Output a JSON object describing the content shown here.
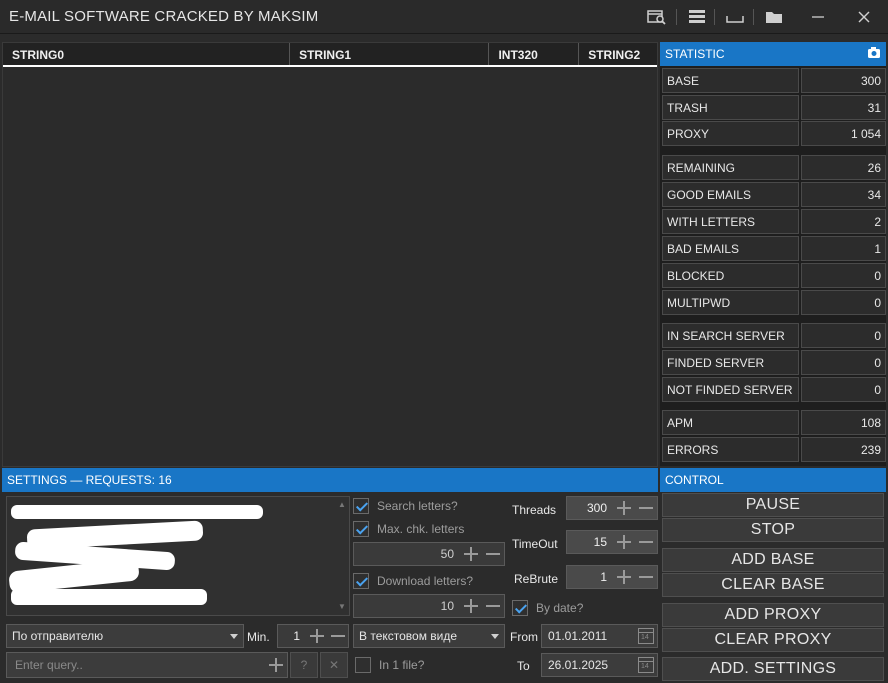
{
  "window": {
    "title": "E-MAIL SOFTWARE CRACKED BY MAKSIM"
  },
  "table": {
    "columns": [
      "STRING0",
      "STRING1",
      "INT320",
      "STRING2"
    ]
  },
  "statistic": {
    "header": "STATISTIC",
    "rows": [
      {
        "label": "BASE",
        "value": "300"
      },
      {
        "label": "TRASH",
        "value": "31"
      },
      {
        "label": "PROXY",
        "value": "1 054"
      },
      {
        "label": "REMAINING",
        "value": "26"
      },
      {
        "label": "GOOD EMAILS",
        "value": "34"
      },
      {
        "label": "WITH LETTERS",
        "value": "2"
      },
      {
        "label": "BAD EMAILS",
        "value": "1"
      },
      {
        "label": "BLOCKED",
        "value": "0"
      },
      {
        "label": "MULTIPWD",
        "value": "0"
      },
      {
        "label": "IN SEARCH SERVER",
        "value": "0"
      },
      {
        "label": "FINDED SERVER",
        "value": "0"
      },
      {
        "label": "NOT FINDED SERVER",
        "value": "0"
      },
      {
        "label": "APM",
        "value": "108"
      },
      {
        "label": "ERRORS",
        "value": "239"
      }
    ]
  },
  "settings": {
    "header": "SETTINGS — REQUESTS: 16",
    "search_letters": "Search letters?",
    "max_chk_letters": "Max. chk. letters",
    "max_chk_value": "50",
    "download_letters": "Download letters?",
    "download_value": "10",
    "threads_label": "Threads",
    "threads_value": "300",
    "timeout_label": "TimeOut",
    "timeout_value": "15",
    "rebrute_label": "ReBrute",
    "rebrute_value": "1",
    "by_date": "By date?",
    "sort_select": "По отправителю",
    "min_label": "Min.",
    "min_value": "1",
    "view_select": "В текстовом виде",
    "from_label": "From",
    "from_date": "01.01.2011",
    "to_label": "To",
    "to_date": "26.01.2025",
    "query_placeholder": "Enter query..",
    "question": "?",
    "clear": "✕",
    "in_one_file": "In 1 file?",
    "calendar_day": "14"
  },
  "control": {
    "header": "CONTROL",
    "buttons": [
      "PAUSE",
      "STOP",
      "ADD BASE",
      "CLEAR BASE",
      "ADD PROXY",
      "CLEAR PROXY",
      "ADD. SETTINGS"
    ]
  },
  "colors": {
    "accent": "#1976c6",
    "check": "#4aa3f0",
    "background": "#2b2b2b"
  }
}
